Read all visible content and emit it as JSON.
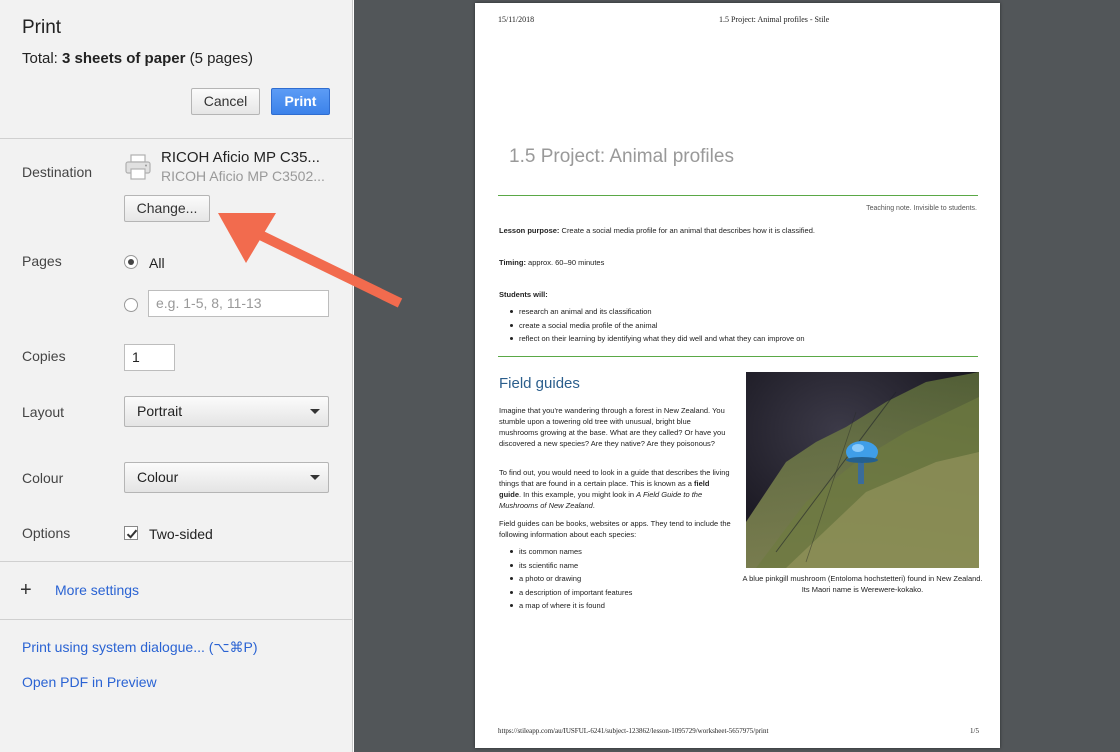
{
  "dialog": {
    "title": "Print",
    "total_prefix": "Total: ",
    "total_bold": "3 sheets of paper",
    "total_suffix": " (5 pages)",
    "cancel_label": "Cancel",
    "print_label": "Print"
  },
  "destination": {
    "label": "Destination",
    "name": "RICOH Aficio MP C35...",
    "sub": "RICOH Aficio MP C3502...",
    "change_label": "Change..."
  },
  "pages": {
    "label": "Pages",
    "all_label": "All",
    "custom_placeholder": "e.g. 1-5, 8, 11-13"
  },
  "copies": {
    "label": "Copies",
    "value": "1"
  },
  "layout": {
    "label": "Layout",
    "value": "Portrait"
  },
  "colour": {
    "label": "Colour",
    "value": "Colour"
  },
  "options": {
    "label": "Options",
    "two_sided_label": "Two-sided",
    "two_sided_checked": true
  },
  "more_settings": {
    "icon": "+",
    "label": "More settings"
  },
  "links": {
    "system_dialogue": "Print using system dialogue... (⌥⌘P)",
    "open_pdf": "Open PDF in Preview"
  },
  "preview": {
    "header_date": "15/11/2018",
    "header_title": "1.5 Project: Animal profiles - Stile",
    "doc_title": "1.5 Project: Animal profiles",
    "teaching_note": "Teaching note. Invisible to students.",
    "lesson_purpose_label": "Lesson purpose:",
    "lesson_purpose_text": " Create a social media profile for an animal that describes how it is classified.",
    "timing_label": "Timing:",
    "timing_text": " approx. 60–90 minutes",
    "students_will_label": "Students will:",
    "students_will": [
      "research an animal and its classification",
      "create a social media profile of the animal",
      "reflect on their learning by identifying what they did well and what they can improve on"
    ],
    "field_guides_title": "Field guides",
    "para1": "Imagine that you're wandering through a forest in New Zealand. You stumble upon a towering old tree with unusual, bright blue mushrooms growing at the base. What are they called? Or have you discovered a new species? Are they native? Are they poisonous?",
    "para2_a": "To find out, you would need to look in a guide that describes the living things that are found in a certain place. This is known as a ",
    "para2_b": "field guide",
    "para2_c": ". In this example, you might look in ",
    "para2_d": "A Field Guide to the Mushrooms of New Zealand",
    "para2_e": ".",
    "para3": "Field guides can be books, websites or apps. They tend to include the following information about each species:",
    "species_info": [
      "its common names",
      "its scientific name",
      "a photo or drawing",
      "a description of important features",
      "a map of where it is found"
    ],
    "caption": "A blue pinkgill mushroom (Entoloma hochstetteri) found in New Zealand. Its Maori name is Werewere-kokako.",
    "footer_url": "https://stileapp.com/au/IUSFUL-6241/subject-123862/lesson-1095729/worksheet-5657975/print",
    "footer_page": "1/5"
  },
  "colors": {
    "accent": "#2a63d3",
    "print_button": "#3c82ea",
    "arrow": "#f26b4e",
    "rule": "#5aa846",
    "preview_bg": "#525659"
  }
}
